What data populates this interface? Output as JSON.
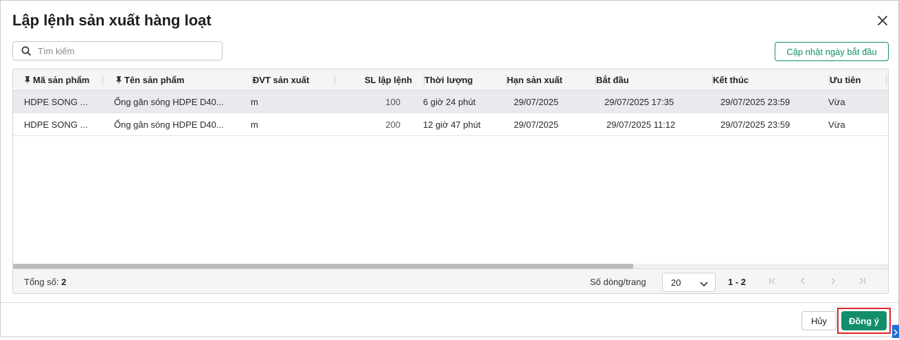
{
  "dialog": {
    "title": "Lập lệnh sản xuất hàng loạt",
    "close_icon": "close-icon"
  },
  "search": {
    "placeholder": "Tìm kiếm",
    "value": "",
    "icon": "search-icon"
  },
  "toolbar": {
    "update_label": "Cập nhật ngày bắt đầu"
  },
  "table": {
    "columns": [
      "Mã sản phẩm",
      "Tên sản phẩm",
      "ĐVT sản xuất",
      "SL lập lệnh",
      "Thời lượng",
      "Hạn sản xuất",
      "Bắt đầu",
      "Kết thúc",
      "Ưu tiên"
    ],
    "rows": [
      [
        "HDPE SONG ...",
        "Ống gân sóng HDPE D40...",
        "m",
        "100",
        "6 giờ 24 phút",
        "29/07/2025",
        "29/07/2025 17:35",
        "29/07/2025 23:59",
        "Vừa"
      ],
      [
        "HDPE SONG ...",
        "Ống gân sóng HDPE D40...",
        "m",
        "200",
        "12 giờ 47 phút",
        "29/07/2025",
        "29/07/2025 11:12",
        "29/07/2025 23:59",
        "Vừa"
      ]
    ],
    "selected_row": 0
  },
  "footer": {
    "total_label": "Tổng số:",
    "total_value": "2",
    "rows_per_page_label": "Số dòng/trang",
    "rows_per_page_value": "20",
    "range": "1 - 2"
  },
  "actions": {
    "cancel_label": "Hủy",
    "ok_label": "Đồng ý"
  },
  "colors": {
    "accent": "#128e6b",
    "highlight": "#e0232a",
    "selected_row": "#e9e9ee"
  }
}
